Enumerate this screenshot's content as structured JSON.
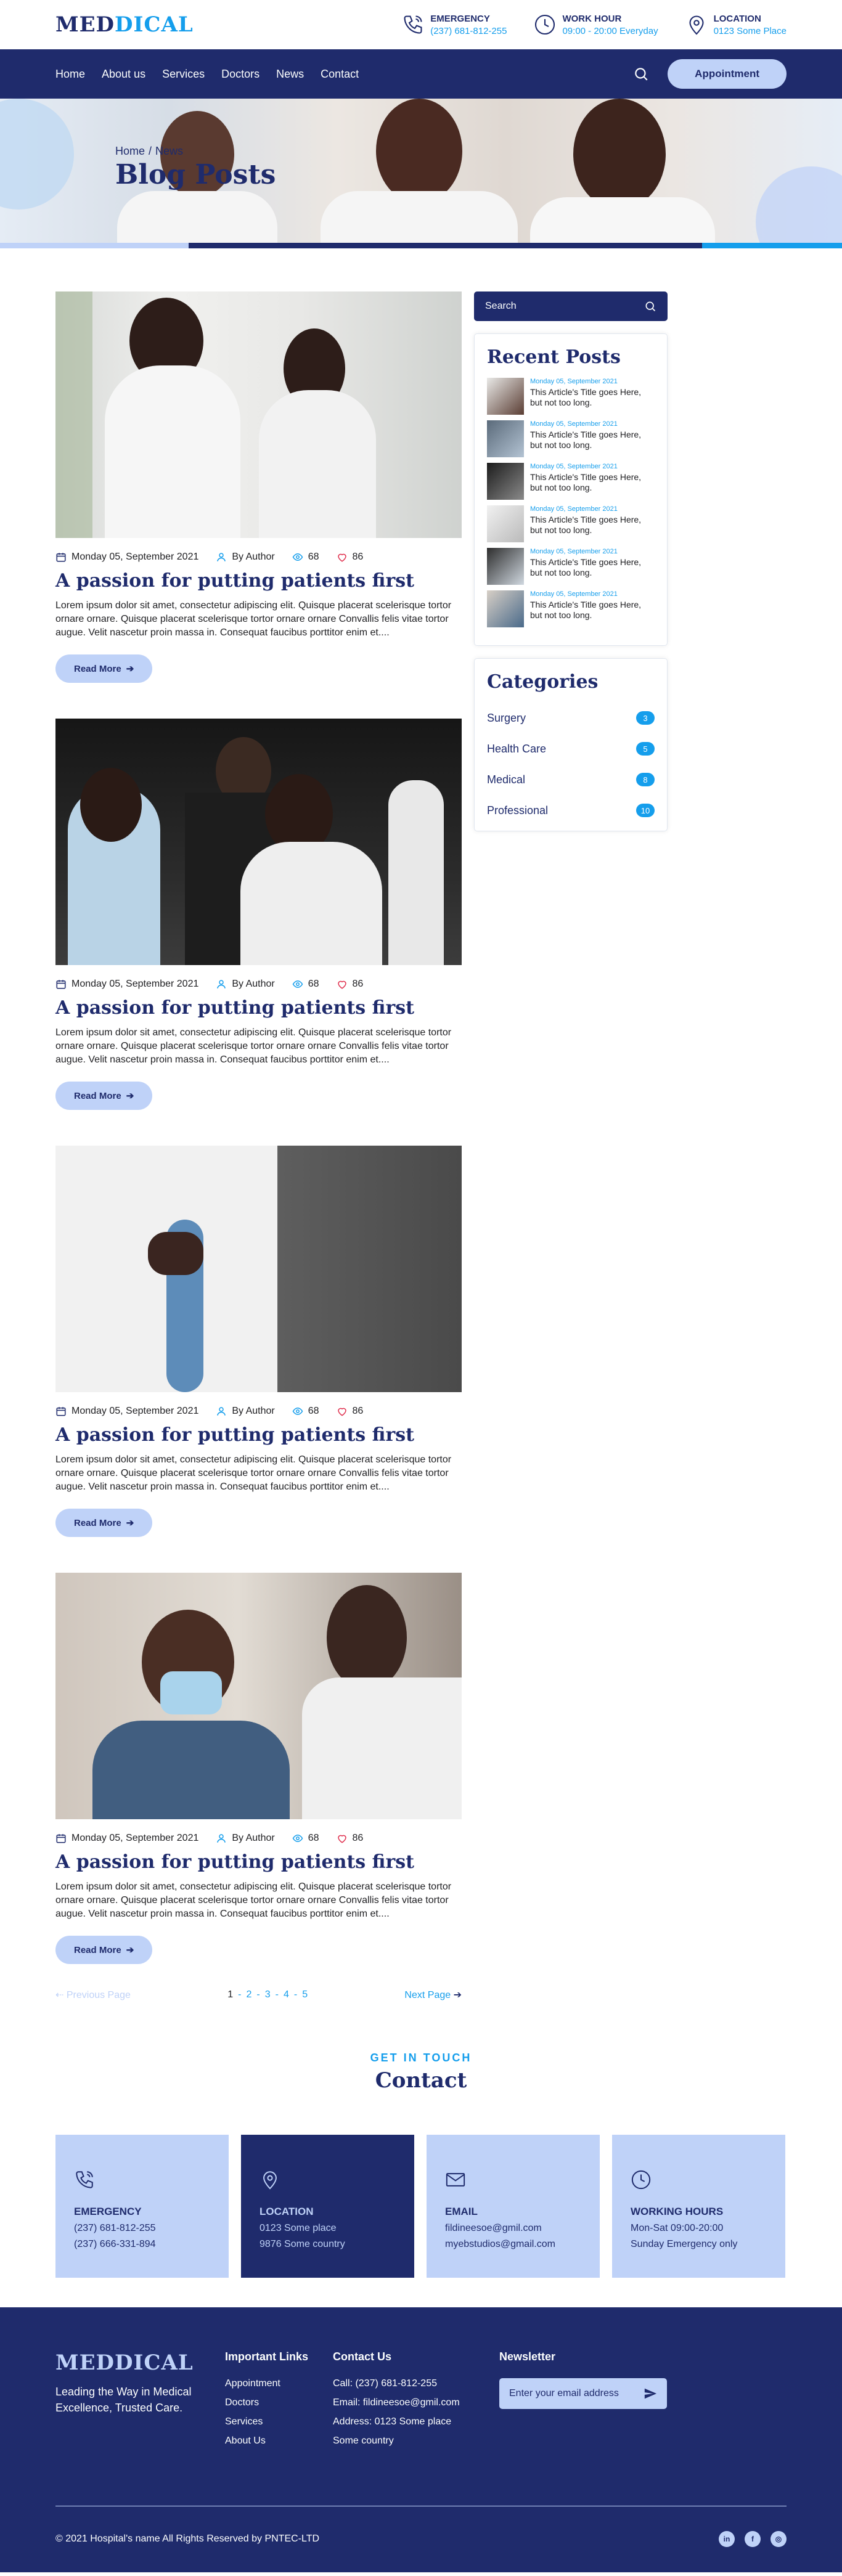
{
  "brand": {
    "part1": "MED",
    "part2": "DICAL"
  },
  "topbar": {
    "items": [
      {
        "title": "EMERGENCY",
        "value": "(237) 681-812-255",
        "icon": "phone-icon"
      },
      {
        "title": "WORK HOUR",
        "value": "09:00 - 20:00 Everyday",
        "icon": "clock-icon"
      },
      {
        "title": "LOCATION",
        "value": "0123 Some Place",
        "icon": "location-icon"
      }
    ]
  },
  "nav": {
    "links": [
      "Home",
      "About us",
      "Services",
      "Doctors",
      "News",
      "Contact"
    ],
    "appointment": "Appointment"
  },
  "hero": {
    "crumb_home": "Home",
    "crumb_sep": "/",
    "crumb_current": "News",
    "title": "Blog Posts"
  },
  "posts": [
    {
      "date": "Monday 05, September 2021",
      "author": "By Author",
      "views": "68",
      "likes": "86",
      "title": "A passion for putting patients first",
      "text": "Lorem ipsum dolor sit amet, consectetur adipiscing elit. Quisque placerat scelerisque tortor ornare ornare. Quisque placerat scelerisque tortor ornare ornare Convallis felis vitae tortor augue. Velit nascetur proin massa in. Consequat faucibus porttitor enim et....",
      "read_more": "Read More"
    },
    {
      "date": "Monday 05, September 2021",
      "author": "By Author",
      "views": "68",
      "likes": "86",
      "title": "A passion for putting patients first",
      "text": "Lorem ipsum dolor sit amet, consectetur adipiscing elit. Quisque placerat scelerisque tortor ornare ornare. Quisque placerat scelerisque tortor ornare ornare Convallis felis vitae tortor augue. Velit nascetur proin massa in. Consequat faucibus porttitor enim et....",
      "read_more": "Read More"
    },
    {
      "date": "Monday 05, September 2021",
      "author": "By Author",
      "views": "68",
      "likes": "86",
      "title": "A passion for putting patients first",
      "text": "Lorem ipsum dolor sit amet, consectetur adipiscing elit. Quisque placerat scelerisque tortor ornare ornare. Quisque placerat scelerisque tortor ornare ornare Convallis felis vitae tortor augue. Velit nascetur proin massa in. Consequat faucibus porttitor enim et....",
      "read_more": "Read More"
    },
    {
      "date": "Monday 05, September 2021",
      "author": "By Author",
      "views": "68",
      "likes": "86",
      "title": "A passion for putting patients first",
      "text": "Lorem ipsum dolor sit amet, consectetur adipiscing elit. Quisque placerat scelerisque tortor ornare ornare. Quisque placerat scelerisque tortor ornare ornare Convallis felis vitae tortor augue. Velit nascetur proin massa in. Consequat faucibus porttitor enim et....",
      "read_more": "Read More"
    }
  ],
  "pagination": {
    "prev": "Previous Page",
    "pages": [
      "1",
      "2",
      "3",
      "4",
      "5"
    ],
    "sep": "-",
    "next": "Next Page"
  },
  "sidebar": {
    "search_placeholder": "Search",
    "recent_title": "Recent Posts",
    "recent": [
      {
        "date": "Monday 05, September 2021",
        "title": "This Article's Title goes Here, but not too long."
      },
      {
        "date": "Monday 05, September 2021",
        "title": "This Article's Title goes Here, but not too long."
      },
      {
        "date": "Monday 05, September 2021",
        "title": "This Article's Title goes Here, but not too long."
      },
      {
        "date": "Monday 05, September 2021",
        "title": "This Article's Title goes Here, but not too long."
      },
      {
        "date": "Monday 05, September 2021",
        "title": "This Article's Title goes Here, but not too long."
      },
      {
        "date": "Monday 05, September 2021",
        "title": "This Article's Title goes Here, but not too long."
      }
    ],
    "categories_title": "Categories",
    "categories": [
      {
        "name": "Surgery",
        "count": "3"
      },
      {
        "name": "Health Care",
        "count": "5"
      },
      {
        "name": "Medical",
        "count": "8"
      },
      {
        "name": "Professional",
        "count": "10"
      }
    ]
  },
  "contact": {
    "kicker": "GET IN TOUCH",
    "title": "Contact",
    "cards": [
      {
        "title": "EMERGENCY",
        "lines": [
          "(237) 681-812-255",
          "(237) 666-331-894"
        ],
        "icon": "phone-icon"
      },
      {
        "title": "LOCATION",
        "lines": [
          "0123 Some place",
          "9876 Some country"
        ],
        "icon": "location-icon"
      },
      {
        "title": "EMAIL",
        "lines": [
          "fildineesoe@gmil.com",
          "myebstudios@gmail.com"
        ],
        "icon": "email-icon"
      },
      {
        "title": "WORKING HOURS",
        "lines": [
          "Mon-Sat 09:00-20:00",
          "Sunday Emergency only"
        ],
        "icon": "clock-icon"
      }
    ]
  },
  "footer": {
    "logo": "MEDDICAL",
    "tagline": "Leading the Way in Medical Excellence, Trusted Care.",
    "links_title": "Important Links",
    "links": [
      "Appointment",
      "Doctors",
      "Services",
      "About Us"
    ],
    "contact_title": "Contact Us",
    "contact_lines": [
      "Call: (237) 681-812-255",
      "Email: fildineesoe@gmil.com",
      "Address: 0123 Some place",
      "Some country"
    ],
    "newsletter_title": "Newsletter",
    "newsletter_placeholder": "Enter your email address",
    "copyright": "© 2021 Hospital's name All Rights Reserved by PNTEC-LTD",
    "socials": [
      "in",
      "f",
      "◎"
    ]
  },
  "colors": {
    "navy": "#1f2b6c",
    "blue": "#159eec",
    "light": "#bfd2f8"
  }
}
